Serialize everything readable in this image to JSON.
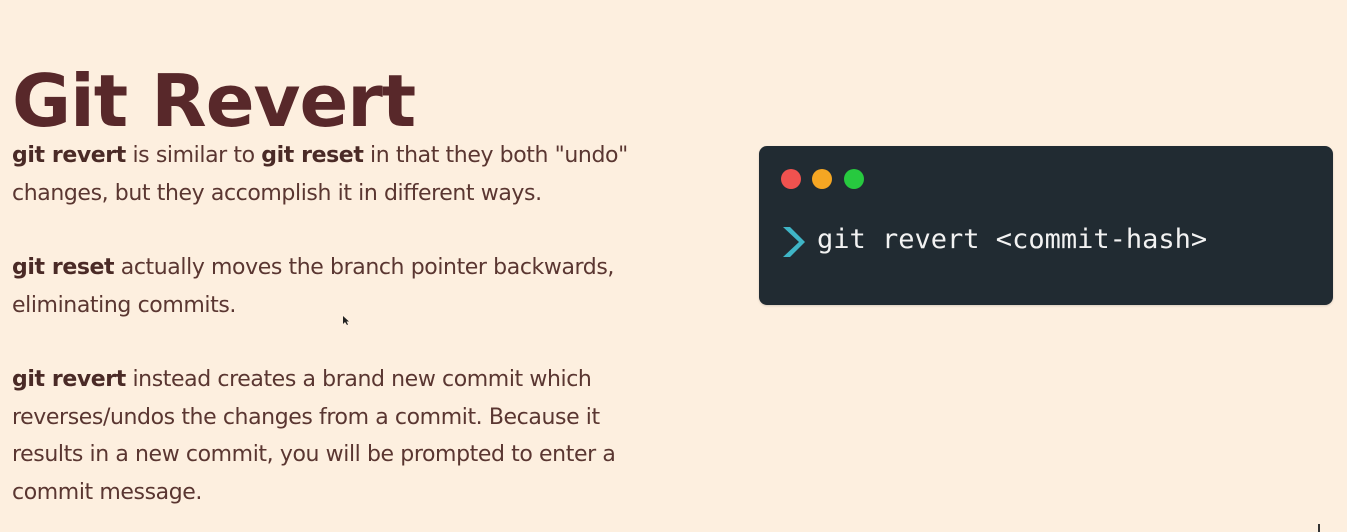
{
  "slide": {
    "title": "Git Revert",
    "paragraphs": [
      {
        "runs": [
          {
            "text": "git revert",
            "bold": true
          },
          {
            "text": " is similar to ",
            "bold": false
          },
          {
            "text": "git reset",
            "bold": true
          },
          {
            "text": " in that they both \"undo\"",
            "bold": false
          },
          {
            "text": "changes, but they accomplish it in different ways.",
            "bold": false,
            "newline": true
          }
        ]
      },
      {
        "runs": [
          {
            "text": "git reset",
            "bold": true
          },
          {
            "text": " actually moves the branch pointer backwards,",
            "bold": false
          },
          {
            "text": "eliminating commits.",
            "bold": false,
            "newline": true
          }
        ]
      },
      {
        "runs": [
          {
            "text": "git revert",
            "bold": true
          },
          {
            "text": " instead creates a brand new commit which",
            "bold": false
          },
          {
            "text": "reverses/undos the changes from a commit. Because it",
            "bold": false,
            "newline": true
          },
          {
            "text": "results in a new commit, you will be prompted to enter a",
            "bold": false,
            "newline": true
          },
          {
            "text": "commit message.",
            "bold": false,
            "newline": true
          }
        ]
      }
    ]
  },
  "terminal": {
    "window_dots": [
      {
        "name": "close",
        "color": "#f0524f"
      },
      {
        "name": "minimize",
        "color": "#f5a623"
      },
      {
        "name": "maximize",
        "color": "#27c93f"
      }
    ],
    "prompt_icon": "chevron-right-icon",
    "prompt_color": "#3fb5c6",
    "command": "git revert <commit-hash>"
  },
  "colors": {
    "background": "#fdefdf",
    "title": "#58282a",
    "body_text": "#5a3631",
    "terminal_bg": "#212b32"
  }
}
